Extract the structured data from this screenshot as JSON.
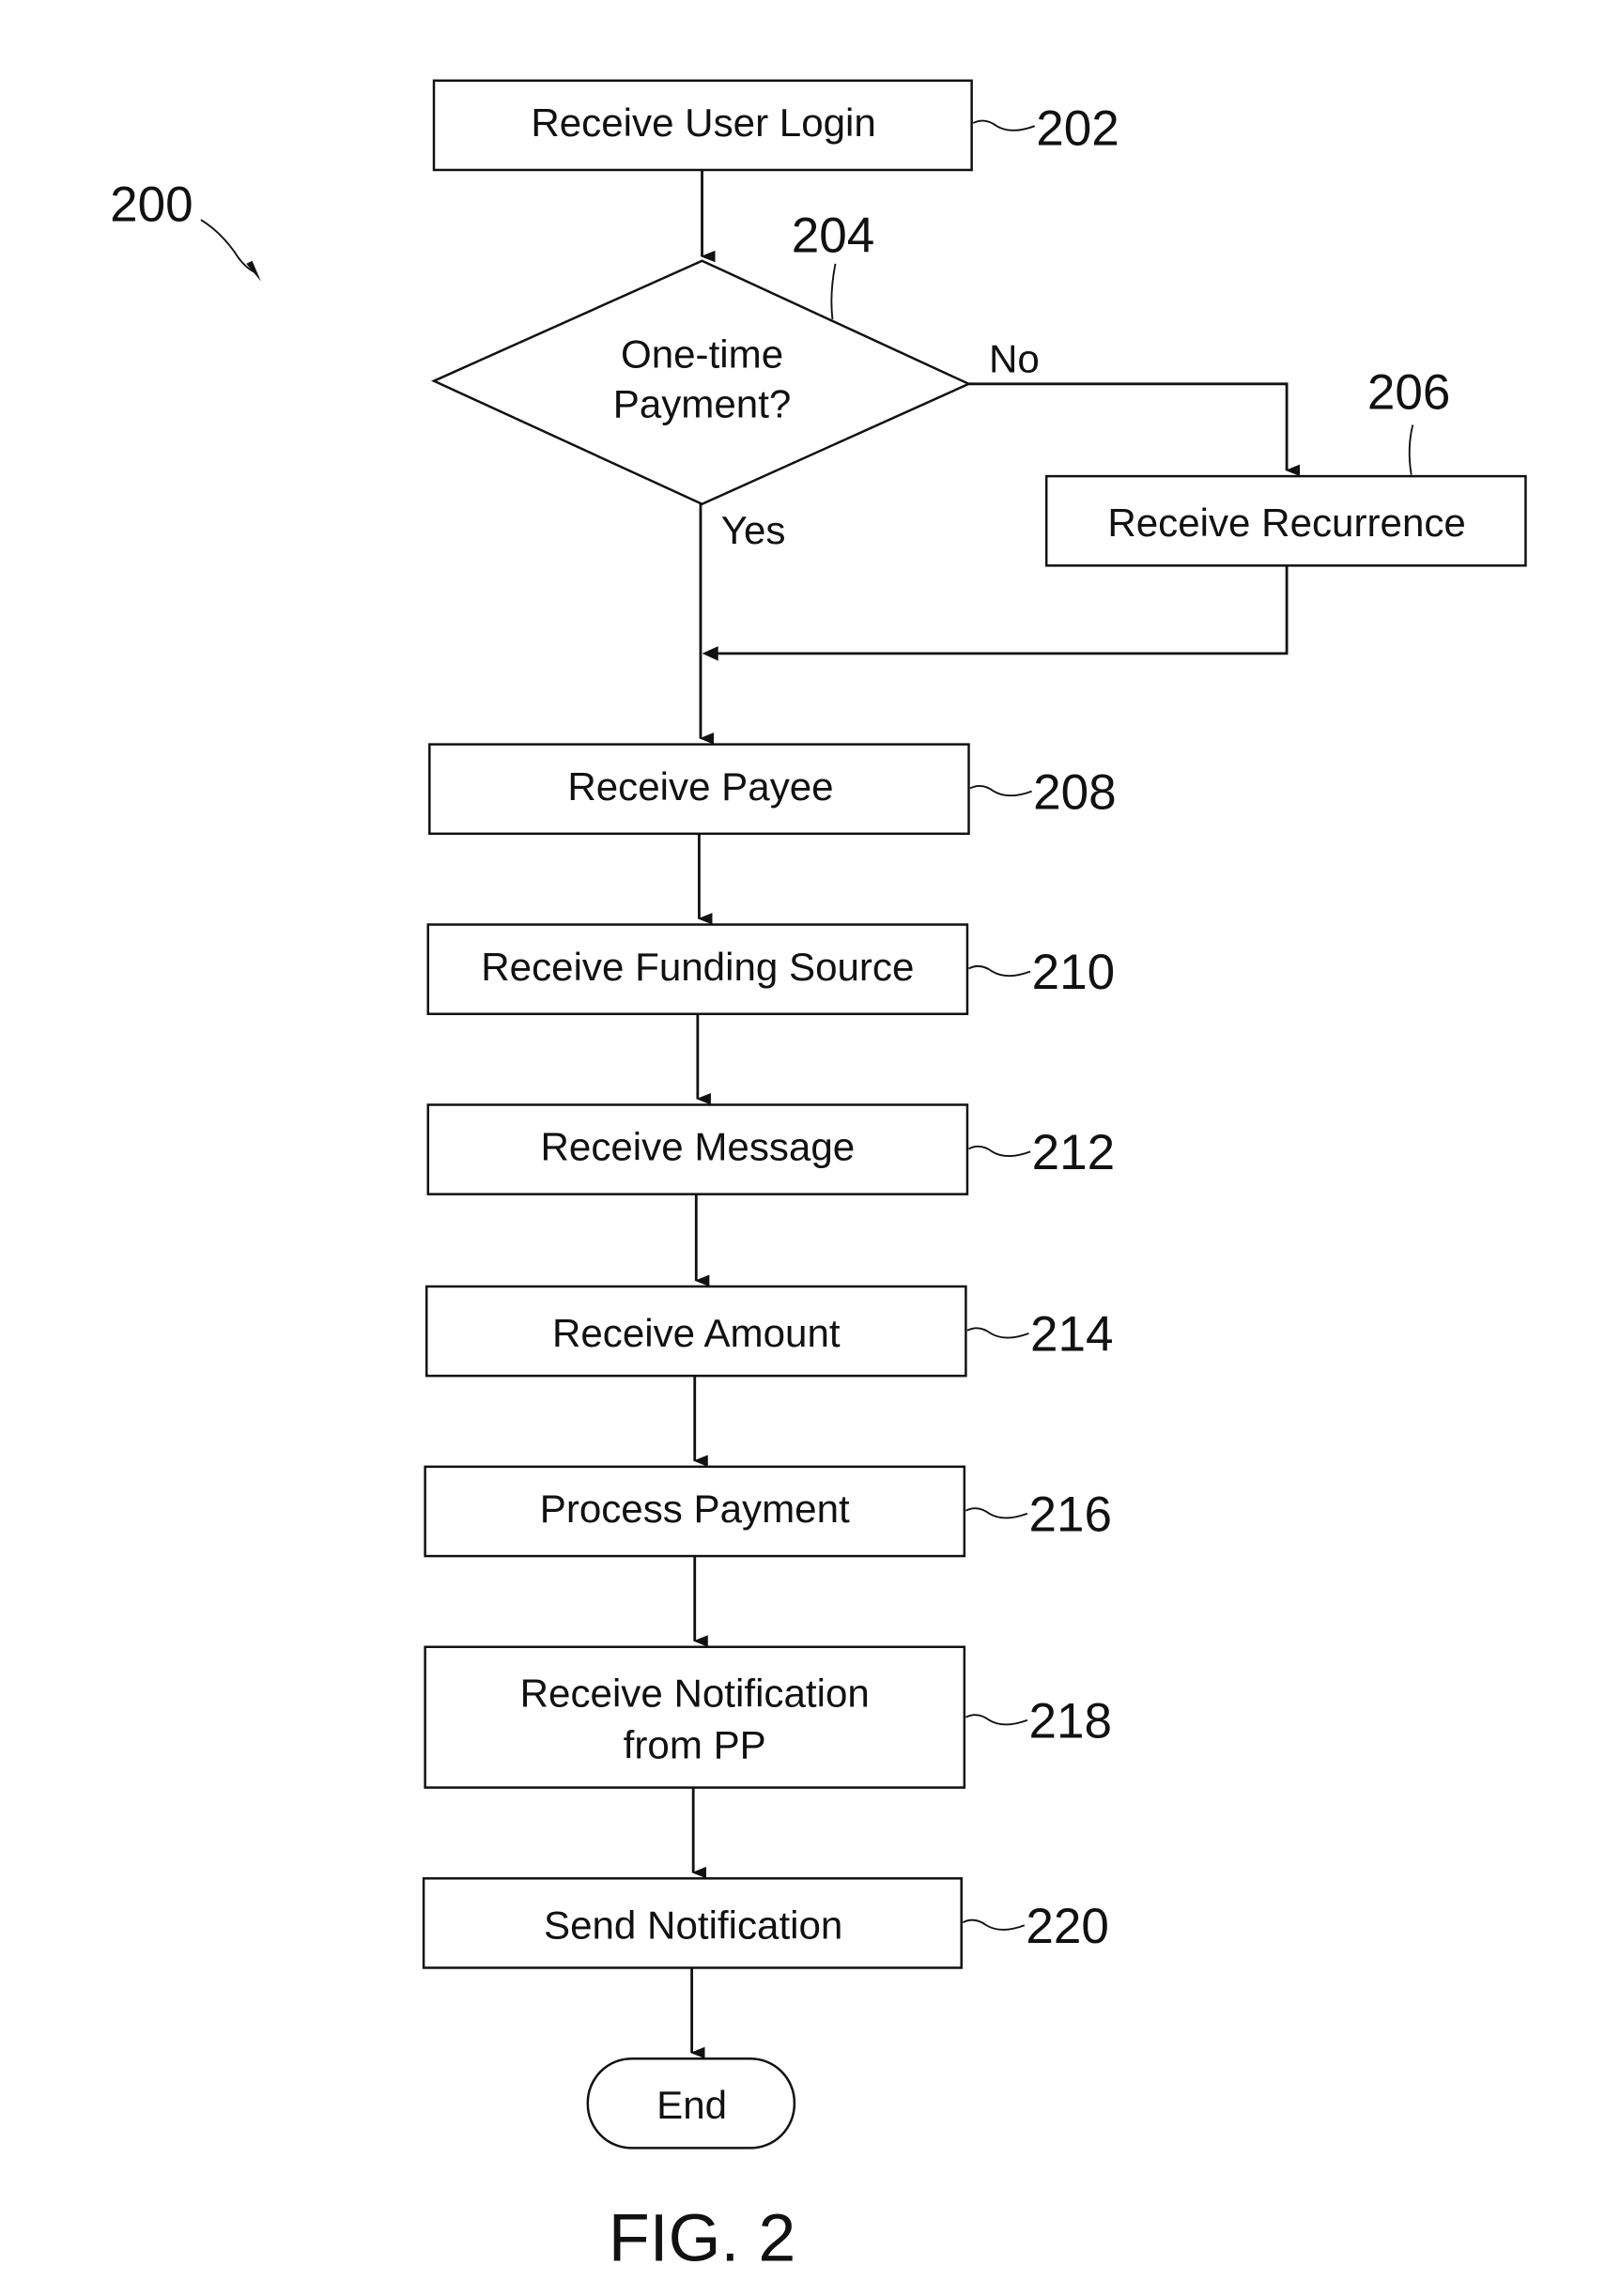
{
  "figure": {
    "number_label": "200",
    "caption": "FIG. 2"
  },
  "steps": {
    "s202": {
      "label": "Receive User Login",
      "ref": "202"
    },
    "s204": {
      "line1": "One-time",
      "line2": "Payment?",
      "ref": "204",
      "no": "No",
      "yes": "Yes"
    },
    "s206": {
      "label": "Receive Recurrence",
      "ref": "206"
    },
    "s208": {
      "label": "Receive Payee",
      "ref": "208"
    },
    "s210": {
      "label": "Receive Funding Source",
      "ref": "210"
    },
    "s212": {
      "label": "Receive Message",
      "ref": "212"
    },
    "s214": {
      "label": "Receive Amount",
      "ref": "214"
    },
    "s216": {
      "label": "Process Payment",
      "ref": "216"
    },
    "s218": {
      "line1": "Receive Notification",
      "line2": "from PP",
      "ref": "218"
    },
    "s220": {
      "label": "Send Notification",
      "ref": "220"
    },
    "end": {
      "label": "End"
    }
  }
}
